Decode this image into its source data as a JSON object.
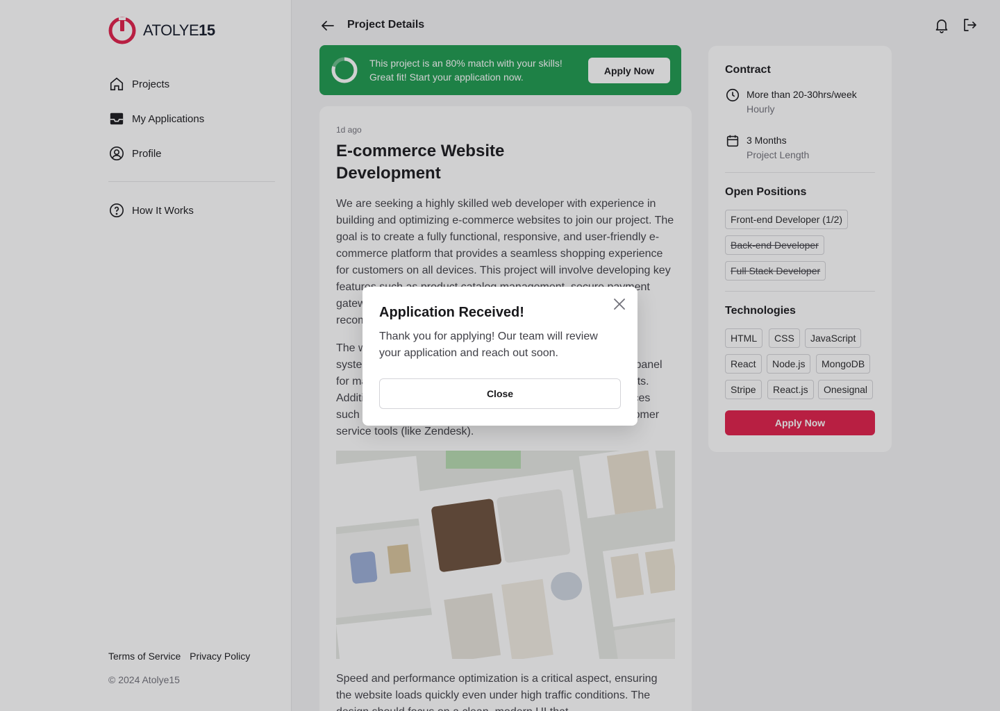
{
  "brand": {
    "name_light": "ATOLYE",
    "name_bold": "15",
    "logo_icon": "power-logo-icon",
    "accent": "#e11d48"
  },
  "sidebar": {
    "items": [
      {
        "label": "Projects",
        "icon": "home-icon"
      },
      {
        "label": "My Applications",
        "icon": "inbox-icon"
      },
      {
        "label": "Profile",
        "icon": "user-circle-icon"
      }
    ],
    "help": {
      "label": "How It Works",
      "icon": "question-circle-icon"
    },
    "footer": {
      "terms": "Terms of Service",
      "privacy": "Privacy Policy",
      "copyright": "© 2024 Atolye15"
    }
  },
  "header": {
    "title": "Project Details",
    "back_icon": "arrow-left-icon",
    "bell_icon": "bell-icon",
    "logout_icon": "logout-icon"
  },
  "banner": {
    "color": "#1c9a4d",
    "match_percent": 80,
    "message": "This project is an 80% match with your skills! Great fit! Start your application now.",
    "button": "Apply Now"
  },
  "project": {
    "posted": "1d ago",
    "title": "E-commerce Website Development",
    "description_1": "We are seeking a highly skilled web developer with experience in building and optimizing e-commerce websites to join our project. The goal is to create a fully functional, responsive, and user-friendly e-commerce platform that provides a seamless shopping experience for customers on all devices. This project will involve developing key features such as product catalog management, secure payment gateways, order processing, customer accounts, product recommendation engines, and purchases, and p",
    "description_2": "The website should also include a robust search and filtering system, vendor management, and an intuitive administrative panel for managing inventory, tracking orders, and generating reports. Additionally, the platform must integrate with third-party services such as payment processors, shipping carrier APIs, and customer service tools (like Zendesk).",
    "description_3": "Speed and performance optimization is a critical aspect, ensuring the website loads quickly even under high traffic conditions. The design should focus on a clean, modern UI that"
  },
  "contract": {
    "heading": "Contract",
    "hours": "More than 20-30hrs/week",
    "hours_sub": "Hourly",
    "length": "3 Months",
    "length_sub": "Project Length"
  },
  "positions": {
    "heading": "Open Positions",
    "items": [
      "Front-end Developer (1/2)",
      "Back-end Developer",
      "Full Stack Developer"
    ]
  },
  "technologies": {
    "heading": "Technologies",
    "items": [
      "HTML",
      "CSS",
      "JavaScript",
      "React",
      "Node.js",
      "MongoDB",
      "Stripe",
      "React.js",
      "Onesignal"
    ]
  },
  "panel_button": "Apply Now",
  "modal": {
    "title": "Application Received!",
    "body": "Thank you for applying! Our team will review your application and reach out soon.",
    "button": "Close"
  }
}
